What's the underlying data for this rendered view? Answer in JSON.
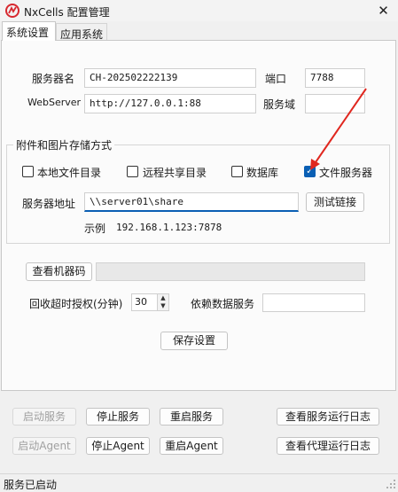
{
  "window": {
    "title": "NxCells 配置管理",
    "close_glyph": "✕"
  },
  "tabs": [
    {
      "label": "系统设置"
    },
    {
      "label": "应用系统"
    }
  ],
  "server": {
    "name_label": "服务器名",
    "name_value": "CH-202502222139",
    "port_label": "端口",
    "port_value": "7788",
    "webserver_label": "WebServer",
    "webserver_value": "http://127.0.0.1:88",
    "domain_label": "服务域",
    "domain_value": ""
  },
  "storage": {
    "group_label": "附件和图片存储方式",
    "options": [
      {
        "label": "本地文件目录",
        "checked": false
      },
      {
        "label": "远程共享目录",
        "checked": false
      },
      {
        "label": "数据库",
        "checked": false
      },
      {
        "label": "文件服务器",
        "checked": true
      }
    ],
    "address_label": "服务器地址",
    "address_value": "\\\\server01\\share",
    "test_button": "测试链接",
    "example_label": "示例",
    "example_value": "192.168.1.123:7878"
  },
  "machine": {
    "button": "查看机器码",
    "value": ""
  },
  "timeout": {
    "label": "回收超时授权(分钟)",
    "value": "30"
  },
  "dependency": {
    "label": "依赖数据服务",
    "value": ""
  },
  "save_button": "保存设置",
  "service_buttons": {
    "start_service": "启动服务",
    "stop_service": "停止服务",
    "restart_service": "重启服务",
    "view_service_log": "查看服务运行日志",
    "start_agent": "启动Agent",
    "stop_agent": "停止Agent",
    "restart_agent": "重启Agent",
    "view_agent_log": "查看代理运行日志"
  },
  "status": {
    "text": "服务已启动"
  },
  "colors": {
    "accent": "#0a5fb4",
    "annotation_arrow": "#e0271f",
    "app_icon": "#d7282f"
  }
}
